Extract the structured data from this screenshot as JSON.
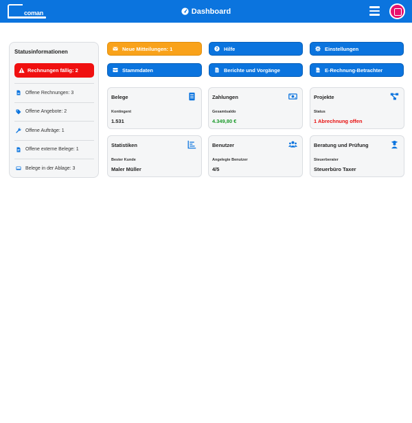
{
  "header": {
    "logo_text": "coman",
    "title": "Dashboard"
  },
  "sidebar": {
    "title": "Statusinformationen",
    "alert": {
      "label": "Rechnungen fällig: 2",
      "color": "#f01010"
    },
    "items": [
      {
        "label": "Offene Rechnungen: 3",
        "icon": "file-icon"
      },
      {
        "label": "Offene Angebote: 2",
        "icon": "tag-icon"
      },
      {
        "label": "Offene Aufträge: 1",
        "icon": "wrench-icon"
      },
      {
        "label": "Offene externe Belege: 1",
        "icon": "file-text-icon"
      },
      {
        "label": "Belege in der Ablage: 3",
        "icon": "inbox-icon"
      }
    ]
  },
  "buttons": {
    "messages": {
      "label": "Neue Mitteilungen: 1",
      "icon": "envelope-icon",
      "color": "#f9a21a"
    },
    "help": {
      "label": "Hilfe",
      "icon": "question-circle-icon"
    },
    "settings": {
      "label": "Einstellungen",
      "icon": "gear-icon"
    },
    "master_data": {
      "label": "Stammdaten",
      "icon": "database-icon"
    },
    "reports": {
      "label": "Berichte und Vorgänge",
      "icon": "file-text-icon"
    },
    "e_invoice": {
      "label": "E-Rechnung-Betrachter",
      "icon": "file-code-icon"
    }
  },
  "cards": {
    "belege": {
      "title": "Belege",
      "label": "Kontingent",
      "value": "1.531",
      "icon": "document-icon"
    },
    "zahlungen": {
      "title": "Zahlungen",
      "label": "Gesamtsaldo",
      "value": "4.349,80 €",
      "icon": "money-icon"
    },
    "projekte": {
      "title": "Projekte",
      "label": "Status",
      "value": "1 Abrechnung offen",
      "icon": "project-diagram-icon"
    },
    "statistiken": {
      "title": "Statistiken",
      "label": "Bester Kunde",
      "value": "Maler Müller",
      "icon": "chart-list-icon"
    },
    "benutzer": {
      "title": "Benutzer",
      "label": "Angelegte Benutzer",
      "value": "4/5",
      "icon": "users-icon"
    },
    "beratung": {
      "title": "Beratung und Prüfung",
      "label": "Steuerberater",
      "value": "Steuerbüro Taxer",
      "icon": "advisor-icon"
    }
  },
  "colors": {
    "brand_blue": "#0b74de",
    "alert_red": "#f01010",
    "warning_orange": "#f9a21a",
    "positive_green": "#1a9a2a",
    "avatar_pink": "#e8116c"
  }
}
